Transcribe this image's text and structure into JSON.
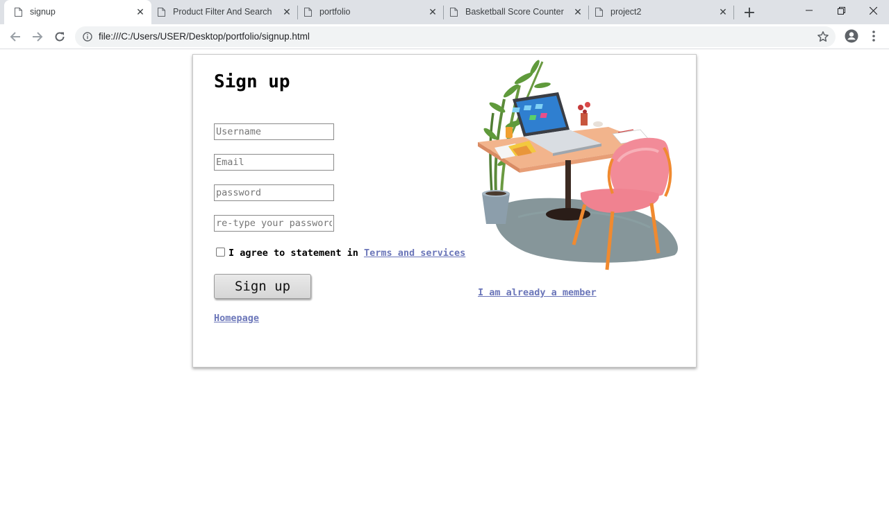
{
  "browser": {
    "tabs": [
      {
        "title": "signup",
        "active": true
      },
      {
        "title": "Product Filter And Search",
        "active": false
      },
      {
        "title": "portfolio",
        "active": false
      },
      {
        "title": "Basketball Score Counter",
        "active": false
      },
      {
        "title": "project2",
        "active": false
      }
    ],
    "url": "file:///C:/Users/USER/Desktop/portfolio/signup.html"
  },
  "page": {
    "title": "Sign up",
    "fields": {
      "username_placeholder": "Username",
      "email_placeholder": "Email",
      "password_placeholder": "password",
      "retype_placeholder": "re-type your password"
    },
    "agree_text": "I agree to statement in",
    "terms_link": "Terms and services",
    "signup_button": "Sign up",
    "homepage_link": "Homepage",
    "member_link": "I am already a member",
    "colors": {
      "link": "#6b76b9",
      "tabstrip": "#dee1e6",
      "omnibox": "#f1f3f4"
    }
  }
}
